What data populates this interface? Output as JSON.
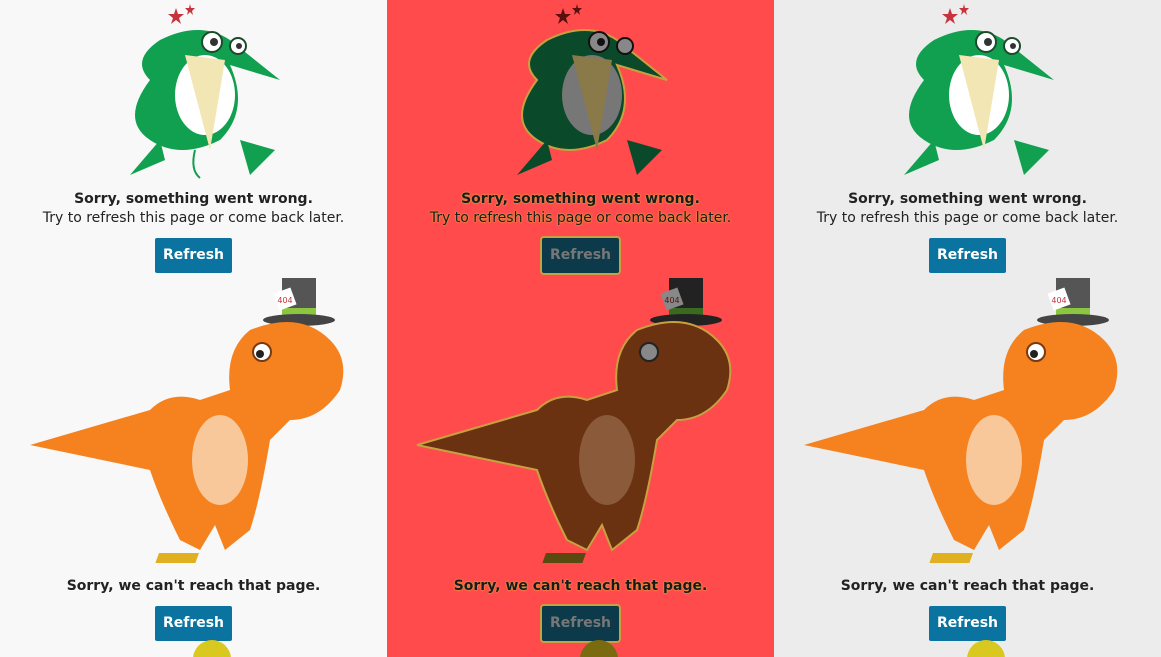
{
  "panels": [
    {
      "theme": "light",
      "error1": {
        "title": "Sorry, something went wrong.",
        "subtitle": "Try to refresh this page or come back later.",
        "button": "Refresh"
      },
      "error2": {
        "title": "Sorry, we can't reach that page.",
        "button": "Refresh",
        "hat_label": "404"
      }
    },
    {
      "theme": "red",
      "error1": {
        "title": "Sorry, something went wrong.",
        "subtitle": "Try to refresh this page or come back later.",
        "button": "Refresh"
      },
      "error2": {
        "title": "Sorry, we can't reach that page.",
        "button": "Refresh",
        "hat_label": "404"
      }
    },
    {
      "theme": "gray",
      "error1": {
        "title": "Sorry, something went wrong.",
        "subtitle": "Try to refresh this page or come back later.",
        "button": "Refresh"
      },
      "error2": {
        "title": "Sorry, we can't reach that page.",
        "button": "Refresh",
        "hat_label": "404"
      }
    }
  ],
  "colors": {
    "panel_light": "#f8f8f8",
    "panel_red": "#ff4b4b",
    "panel_gray": "#ececec",
    "button": "#0a73a0",
    "bird_green": "#10a050",
    "dino_orange": "#f5821f"
  },
  "icons": [
    "hummingbird-illustration",
    "dinosaur-illustration",
    "stars-icon",
    "top-hat-icon"
  ]
}
